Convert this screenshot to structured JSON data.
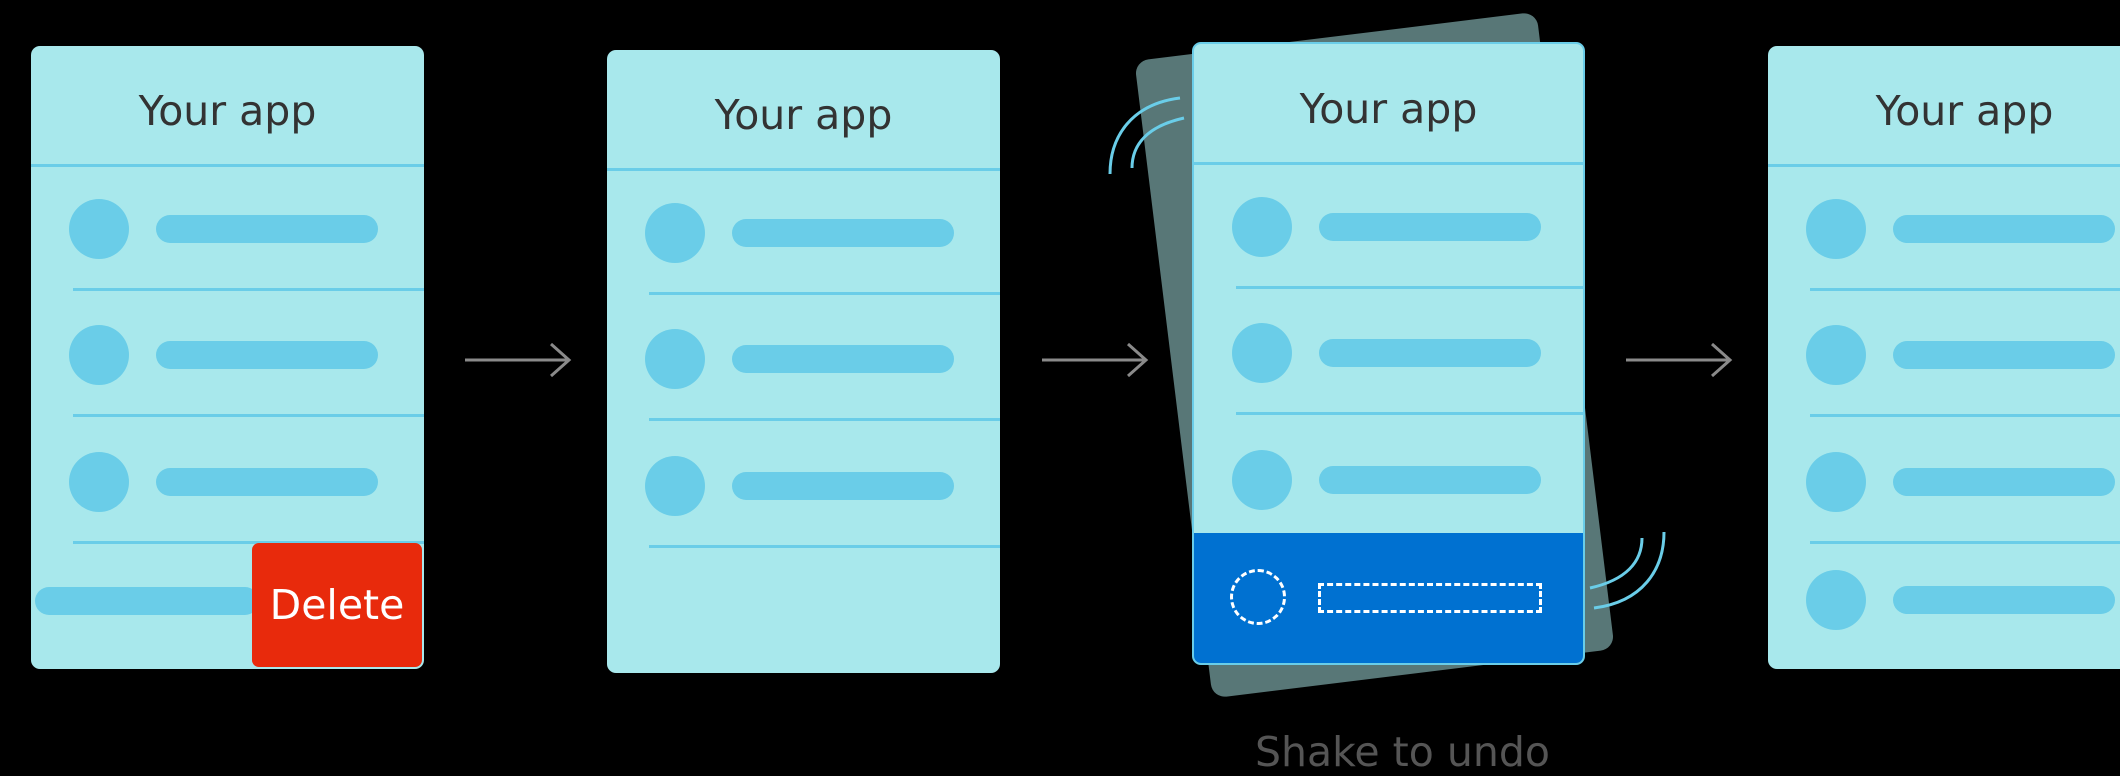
{
  "colors": {
    "background": "#000000",
    "card": "#a8e8ec",
    "title": "#333333",
    "accent": "#6acde8",
    "line": "#6acde8",
    "delete": "#e82a0c",
    "highlight": "#0071d1",
    "back_card": "#587777",
    "arrow": "#8a8a8a",
    "caption": "#555555"
  },
  "steps": [
    {
      "title": "Your app",
      "rows": 3,
      "action": "Delete"
    },
    {
      "title": "Your app",
      "rows": 3
    },
    {
      "title": "Your app",
      "rows": 3,
      "undo_row": true
    },
    {
      "title": "Your app",
      "rows": 4
    }
  ],
  "caption": "Shake to undo"
}
